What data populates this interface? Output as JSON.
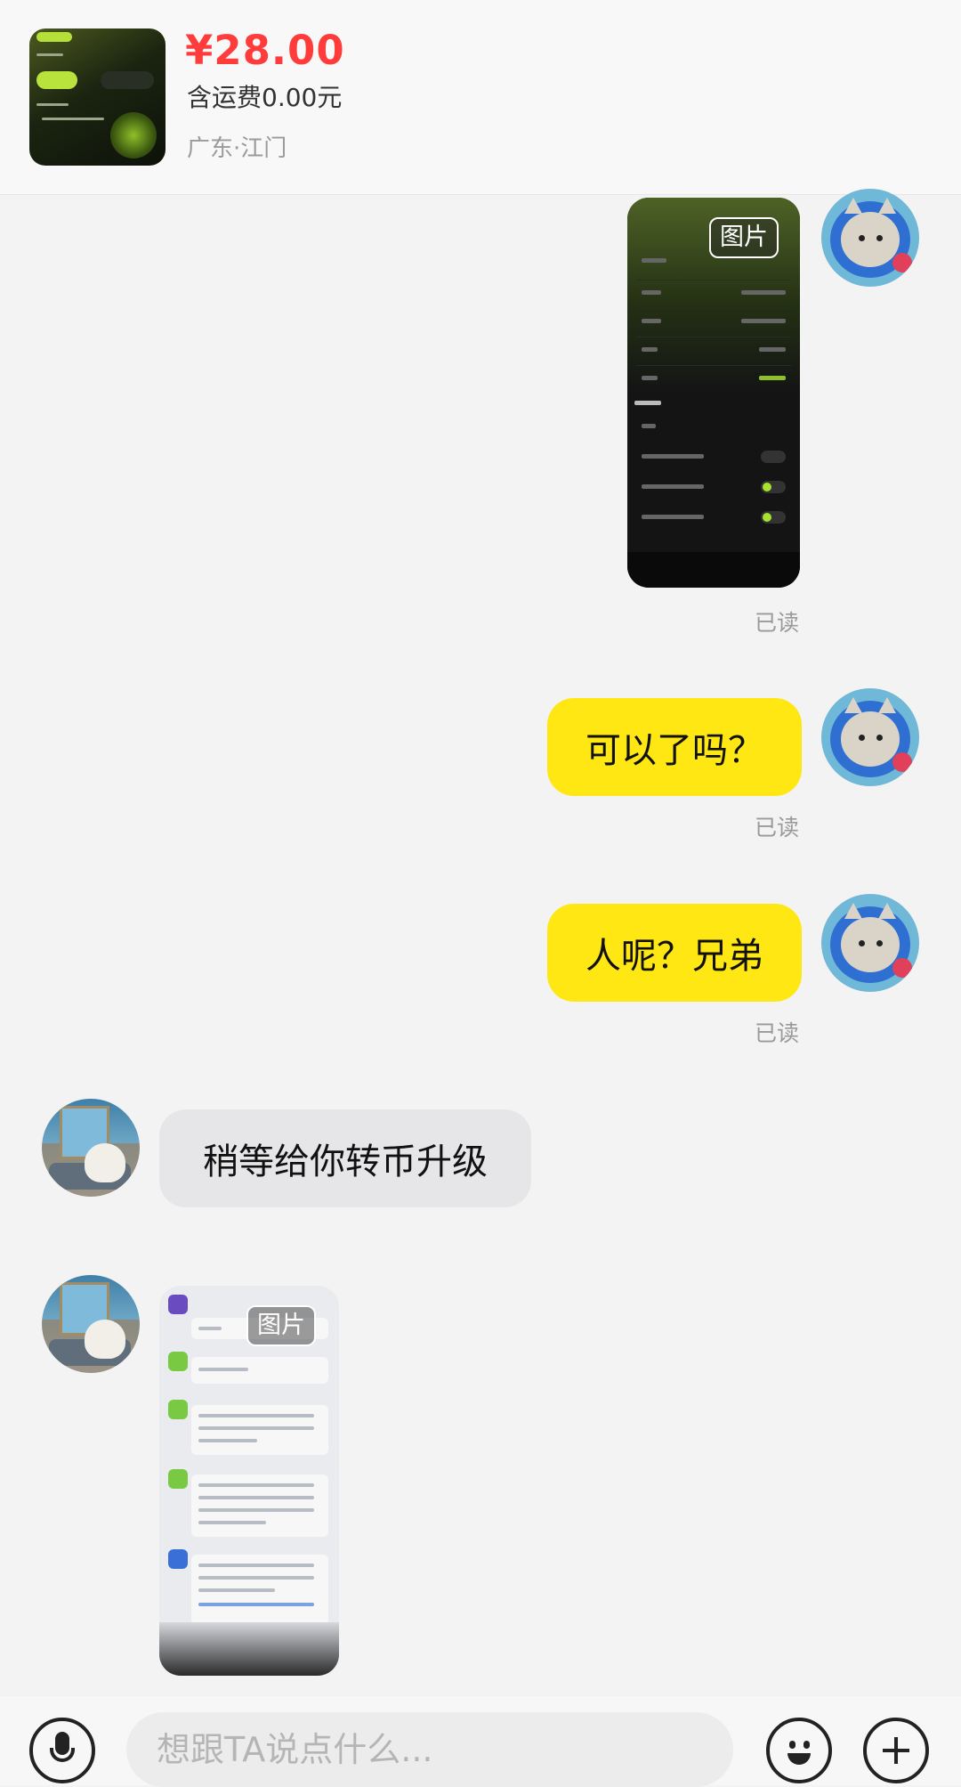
{
  "product": {
    "price": "¥28.00",
    "shipping": "含运费0.00元",
    "location": "广东·江门"
  },
  "messages": [
    {
      "sender": "me",
      "type": "image",
      "badge": "图片",
      "status": "已读"
    },
    {
      "sender": "me",
      "type": "text",
      "text": "可以了吗？",
      "status": "已读"
    },
    {
      "sender": "me",
      "type": "text",
      "text": "人呢？兄弟",
      "status": "已读"
    },
    {
      "sender": "other",
      "type": "text",
      "text": "稍等给你转币升级"
    },
    {
      "sender": "other",
      "type": "image",
      "badge": "图片"
    }
  ],
  "input": {
    "placeholder": "想跟TA说点什么..."
  },
  "icons": {
    "voice": "microphone-icon",
    "emoji": "emoji-icon",
    "more": "plus-icon"
  },
  "colors": {
    "price": "#ff3c3c",
    "my_bubble": "#ffe714",
    "other_bubble": "#e6e6e8"
  }
}
